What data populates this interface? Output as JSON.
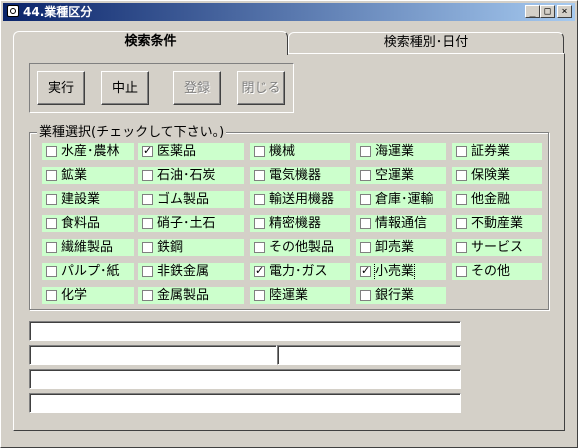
{
  "window": {
    "title": "44.業種区分"
  },
  "title_buttons": {
    "minimize": "_",
    "maximize": "□",
    "close": "×"
  },
  "tabs": [
    {
      "label": "検索条件",
      "active": true
    },
    {
      "label": "検索種別･日付",
      "active": false
    }
  ],
  "buttons": {
    "execute": {
      "label": "実行",
      "enabled": true
    },
    "stop": {
      "label": "中止",
      "enabled": true
    },
    "register": {
      "label": "登録",
      "enabled": false
    },
    "close": {
      "label": "閉じる",
      "enabled": false
    }
  },
  "industry_group": {
    "legend": "業種選択(チェックして下さい。)",
    "items": [
      {
        "label": "水産･農林",
        "checked": false
      },
      {
        "label": "医薬品",
        "checked": true
      },
      {
        "label": "機械",
        "checked": false
      },
      {
        "label": "海運業",
        "checked": false
      },
      {
        "label": "証券業",
        "checked": false
      },
      {
        "label": "鉱業",
        "checked": false
      },
      {
        "label": "石油･石炭",
        "checked": false
      },
      {
        "label": "電気機器",
        "checked": false
      },
      {
        "label": "空運業",
        "checked": false
      },
      {
        "label": "保険業",
        "checked": false
      },
      {
        "label": "建設業",
        "checked": false
      },
      {
        "label": "ゴム製品",
        "checked": false
      },
      {
        "label": "輸送用機器",
        "checked": false
      },
      {
        "label": "倉庫･運輸",
        "checked": false
      },
      {
        "label": "他金融",
        "checked": false
      },
      {
        "label": "食料品",
        "checked": false
      },
      {
        "label": "硝子･土石",
        "checked": false
      },
      {
        "label": "精密機器",
        "checked": false
      },
      {
        "label": "情報通信",
        "checked": false
      },
      {
        "label": "不動産業",
        "checked": false
      },
      {
        "label": "繊維製品",
        "checked": false
      },
      {
        "label": "鉄鋼",
        "checked": false
      },
      {
        "label": "その他製品",
        "checked": false
      },
      {
        "label": "卸売業",
        "checked": false
      },
      {
        "label": "サービス",
        "checked": false
      },
      {
        "label": "パルプ･紙",
        "checked": false
      },
      {
        "label": "非鉄金属",
        "checked": false
      },
      {
        "label": "電力･ガス",
        "checked": true
      },
      {
        "label": "小売業",
        "checked": true
      },
      {
        "label": "その他",
        "checked": false
      },
      {
        "label": "化学",
        "checked": false
      },
      {
        "label": "金属製品",
        "checked": false
      },
      {
        "label": "陸運業",
        "checked": false
      },
      {
        "label": "銀行業",
        "checked": false
      }
    ]
  },
  "text_fields": [
    "",
    "",
    "",
    "",
    ""
  ]
}
